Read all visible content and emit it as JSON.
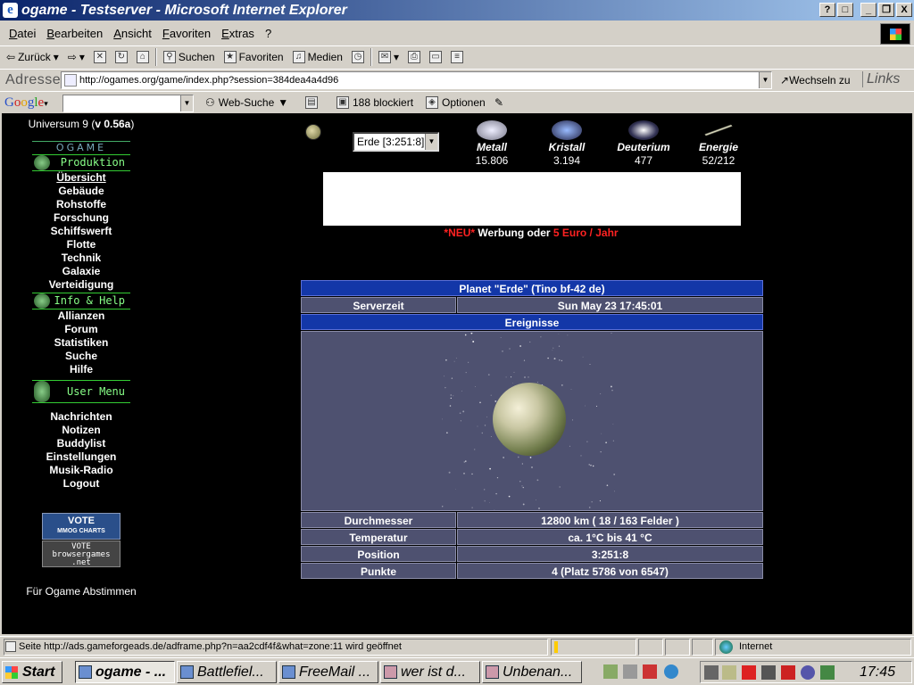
{
  "window": {
    "title": "ogame - Testserver - Microsoft Internet Explorer",
    "controls": {
      "help": "?",
      "minimize": "_",
      "maximize": "□",
      "restore": "❐",
      "close": "X"
    }
  },
  "menu": [
    "Datei",
    "Bearbeiten",
    "Ansicht",
    "Favoriten",
    "Extras",
    "?"
  ],
  "toolbar": {
    "back": "Zurück",
    "search": "Suchen",
    "favorites": "Favoriten",
    "media": "Medien"
  },
  "address": {
    "label": "Adresse",
    "url": "http://ogames.org/game/index.php?session=384dea4a4d96",
    "go": "Wechseln zu",
    "links": "Links"
  },
  "google": {
    "logo_letters": [
      {
        "ch": "G",
        "color": "#2850c8"
      },
      {
        "ch": "o",
        "color": "#d02020"
      },
      {
        "ch": "o",
        "color": "#e0a000"
      },
      {
        "ch": "g",
        "color": "#2850c8"
      },
      {
        "ch": "l",
        "color": "#20a020"
      },
      {
        "ch": "e",
        "color": "#d02020"
      }
    ],
    "search_label": "Web-Suche",
    "blocked": "188 blockiert",
    "options": "Optionen"
  },
  "sidebar": {
    "universe_prefix": "Universum 9 (",
    "universe_version": "v 0.56a",
    "universe_suffix": ")",
    "logo": "OGAME",
    "production_header": "Produktion",
    "production_items": [
      "Übersicht",
      "Gebäude",
      "Rohstoffe",
      "Forschung",
      "Schiffswerft",
      "Flotte",
      "Technik",
      "Galaxie",
      "Verteidigung"
    ],
    "info_header": "Info & Help",
    "info_items": [
      "Allianzen",
      "Forum",
      "Statistiken",
      "Suche",
      "Hilfe"
    ],
    "user_header": "User Menu",
    "user_items": [
      "Nachrichten",
      "Notizen",
      "Buddylist",
      "Einstellungen",
      "Musik-Radio",
      "Logout"
    ],
    "vote1_title": "VOTE",
    "vote1_sub": "MMOG CHARTS",
    "vote2_title": "VOTE",
    "vote2_sub": "browsergames",
    "vote2_tld": ".net",
    "vote_caption": "Für Ogame Abstimmen"
  },
  "planet_select": "Erde [3:251:8]",
  "resources": [
    {
      "name": "Metall",
      "value": "15.806",
      "color": "#c8ccd8"
    },
    {
      "name": "Kristall",
      "value": "3.194",
      "color": "#3060d0"
    },
    {
      "name": "Deuterium",
      "value": "477",
      "color": "#dde8ff"
    },
    {
      "name": "Energie",
      "value": "52/212",
      "color": "#e8e890"
    }
  ],
  "ad": {
    "new": "*NEU*",
    "mid": " Werbung oder ",
    "price": "5 Euro / Jahr"
  },
  "overview": {
    "planet_title": "Planet \"Erde\" (Tino bf-42 de)",
    "servertime_label": "Serverzeit",
    "servertime_value": "Sun May 23 17:45:01",
    "events": "Ereignisse",
    "details": [
      {
        "label": "Durchmesser",
        "value": "12800 km ( 18 / 163 Felder )"
      },
      {
        "label": "Temperatur",
        "value": "ca. 1°C bis 41 °C"
      },
      {
        "label": "Position",
        "value": "3:251:8"
      },
      {
        "label": "Punkte",
        "value": "4 (Platz 5786 von 6547)"
      }
    ]
  },
  "statusbar": {
    "text": "Seite http://ads.gameforgeads.de/adframe.php?n=aa2cdf4f&what=zone:11 wird geöffnet",
    "zone": "Internet"
  },
  "taskbar": {
    "start": "Start",
    "tasks": [
      "ogame - ...",
      "Battlefiel...",
      "FreeMail ...",
      "wer ist d...",
      "Unbenan..."
    ],
    "clock": "17:45"
  }
}
